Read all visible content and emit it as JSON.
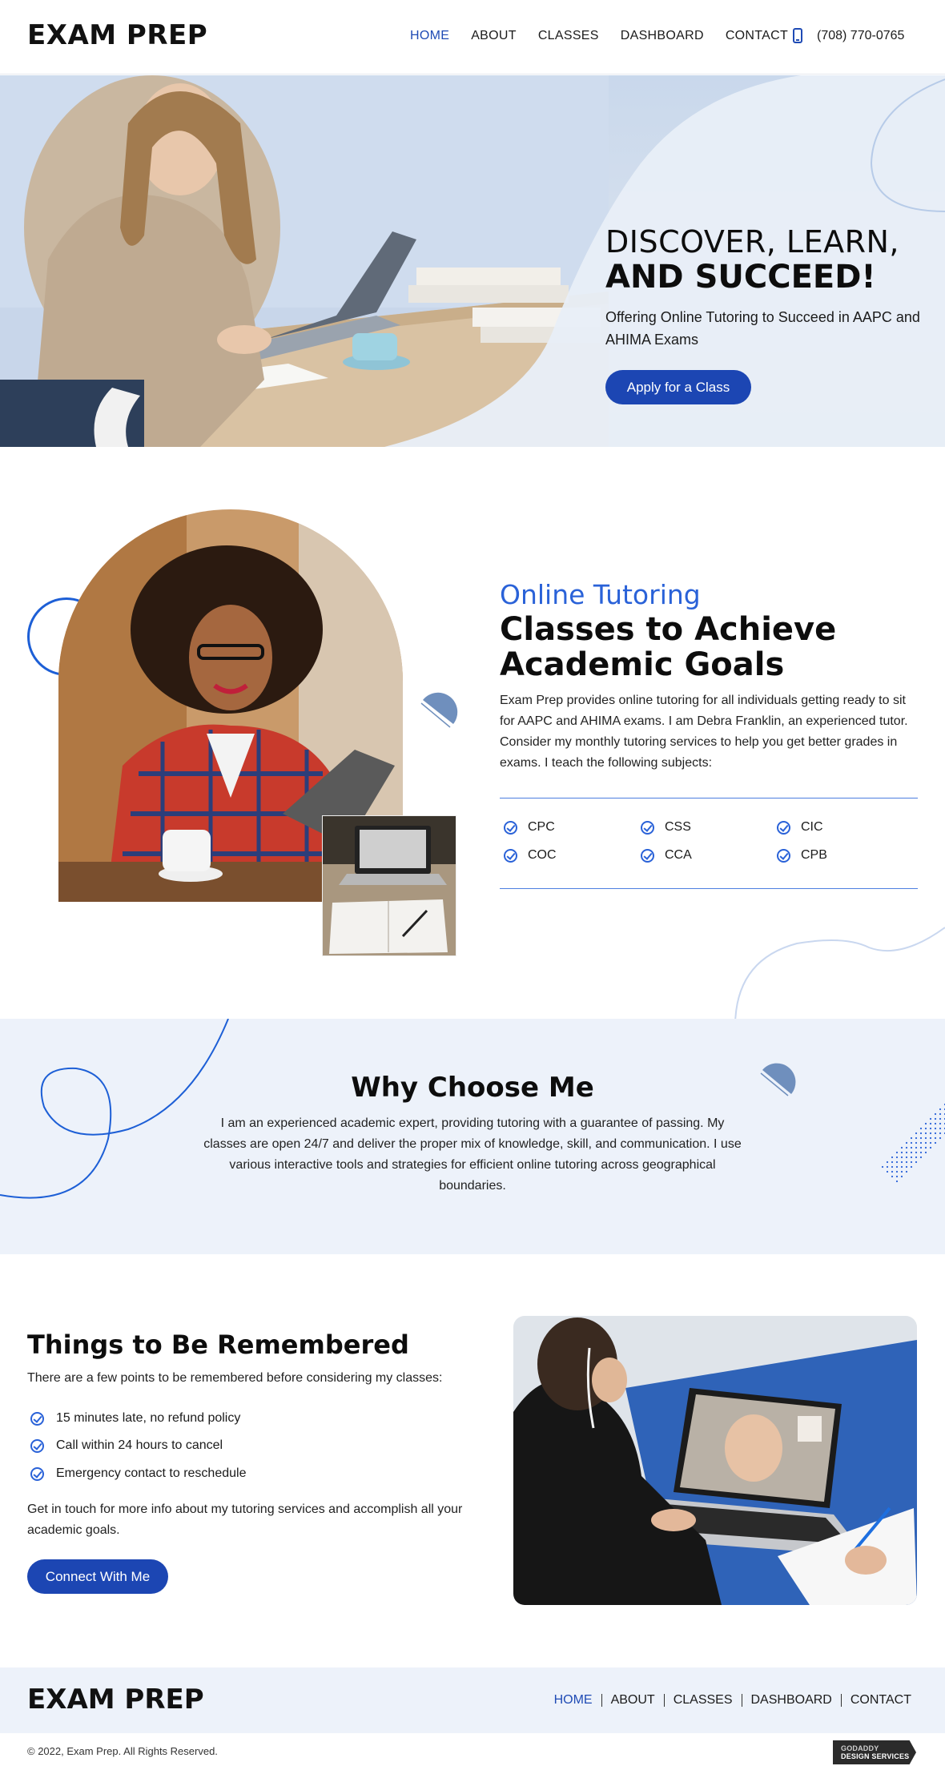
{
  "header": {
    "logo": "EXAM PREP",
    "nav": [
      "HOME",
      "ABOUT",
      "CLASSES",
      "DASHBOARD",
      "CONTACT"
    ],
    "active_nav": "HOME",
    "phone": "(708) 770-0765"
  },
  "hero": {
    "title_line1": "DISCOVER, LEARN,",
    "title_line2": "AND SUCCEED!",
    "subtitle": "Offering Online Tutoring to Succeed in AAPC and AHIMA Exams",
    "button": "Apply for a Class"
  },
  "tutoring": {
    "eyebrow": "Online Tutoring",
    "title": "Classes to Achieve Academic Goals",
    "body": "Exam Prep provides online tutoring for all individuals getting ready to sit for AAPC and AHIMA exams. I am Debra Franklin, an experienced tutor. Consider my monthly tutoring services to help you get better grades in exams. I teach the following subjects:",
    "subjects": [
      "CPC",
      "CSS",
      "CIC",
      "COC",
      "CCA",
      "CPB"
    ]
  },
  "why": {
    "title": "Why Choose Me",
    "body": "I am an experienced academic expert, providing tutoring with a guarantee of passing. My classes are open 24/7 and deliver the proper mix of knowledge, skill, and communication. I use various interactive tools and strategies for efficient online tutoring across geographical boundaries."
  },
  "remember": {
    "title": "Things to Be Remembered",
    "intro": "There are a few points to be remembered before considering my classes:",
    "items": [
      "15 minutes late, no refund policy",
      "Call within 24 hours to cancel",
      "Emergency contact to reschedule"
    ],
    "outro": "Get in touch for more info about my tutoring services and accomplish all your academic goals.",
    "button": "Connect With Me"
  },
  "footer": {
    "logo": "EXAM PREP",
    "nav": [
      "HOME",
      "ABOUT",
      "CLASSES",
      "DASHBOARD",
      "CONTACT"
    ],
    "copyright": "© 2022, Exam Prep. All Rights Reserved.",
    "badge_line1": "GODADDY",
    "badge_line2": "DESIGN SERVICES"
  },
  "colors": {
    "accent": "#1c46b3",
    "link_blue": "#2a62d8",
    "section_bg": "#edf2fa"
  }
}
